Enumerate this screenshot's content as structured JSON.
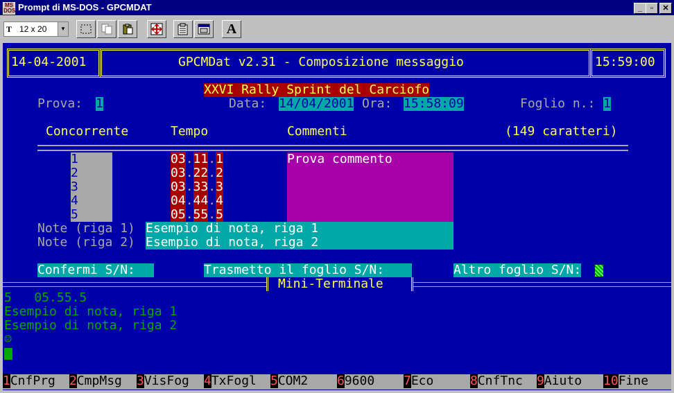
{
  "window": {
    "title": "Prompt di MS-DOS - GPCMDAT",
    "icon_text": "MS\nDOS",
    "controls": {
      "minimize": "_",
      "maximize": "▫",
      "close": "✕"
    }
  },
  "toolbar": {
    "font_size_value": "12 x 20",
    "font_icon": "T"
  },
  "header": {
    "date": "14-04-2001",
    "title": "GPCMDat v2.31 - Composizione messaggio",
    "time": "15:59:00"
  },
  "event": {
    "name": "XXVI Rally Sprint del Carciofo",
    "prova_label": "Prova:",
    "prova_value": "1",
    "data_label": "Data:",
    "data_value": "14/04/2001",
    "ora_label": "Ora:",
    "ora_value": "15:58:09",
    "foglio_label": "Foglio n.:",
    "foglio_value": "1"
  },
  "columns": {
    "concorrente": "Concorrente",
    "tempo": "Tempo",
    "commenti": "Commenti",
    "caratteri": "(149 caratteri)"
  },
  "rows": [
    {
      "concorrente": "1",
      "tempo": [
        "03",
        "11",
        "1"
      ],
      "commento": "Prova commento"
    },
    {
      "concorrente": "2",
      "tempo": [
        "03",
        "22",
        "2"
      ],
      "commento": ""
    },
    {
      "concorrente": "3",
      "tempo": [
        "03",
        "33",
        "3"
      ],
      "commento": ""
    },
    {
      "concorrente": "4",
      "tempo": [
        "04",
        "44",
        "4"
      ],
      "commento": ""
    },
    {
      "concorrente": "5",
      "tempo": [
        "05",
        "55",
        "5"
      ],
      "commento": ""
    }
  ],
  "notes": {
    "label1": "Note (riga 1)",
    "value1": "Esempio di nota, riga 1",
    "label2": "Note (riga 2)",
    "value2": "Esempio di nota, riga 2"
  },
  "prompts": {
    "confermi": "Confermi S/N:",
    "trasmetto": "Trasmetto il foglio S/N:",
    "altro": "Altro foglio S/N:"
  },
  "terminal": {
    "title": "Mini-Terminale",
    "lines": [
      "5   05.55.5",
      "Esempio di nota, riga 1",
      "Esempio di nota, riga 2",
      "☺"
    ]
  },
  "function_keys": [
    {
      "num": "1",
      "label": "CnfPrg"
    },
    {
      "num": "2",
      "label": "CmpMsg"
    },
    {
      "num": "3",
      "label": "VisFog"
    },
    {
      "num": "4",
      "label": "TxFogl"
    },
    {
      "num": "5",
      "label": "COM2"
    },
    {
      "num": "6",
      "label": "9600"
    },
    {
      "num": "7",
      "label": "Eco"
    },
    {
      "num": "8",
      "label": "CnfTnc"
    },
    {
      "num": "9",
      "label": "Aiuto"
    },
    {
      "num": "10",
      "label": "Fine"
    }
  ],
  "colors": {
    "console_bg": "#0000a8",
    "title_bar": "#000080",
    "header_yellow": "#ffff55",
    "field_teal": "#00a8a8",
    "field_red": "#a80000",
    "comment_magenta": "#a800a8",
    "terminal_green": "#00a800"
  }
}
